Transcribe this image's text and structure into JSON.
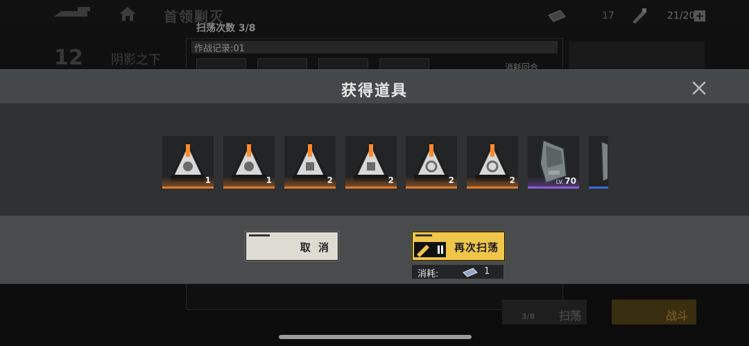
{
  "header": {
    "stage_title": "首领剿灭",
    "sweep_count": "扫荡次数 3/8",
    "tickets": "17",
    "energy": "21/200"
  },
  "background": {
    "stage_number": "12",
    "stage_name": "阴影之下",
    "record_title": "作战记录:01",
    "cost_rounds": "消耗回合",
    "bottom_count": "3/8",
    "bottom_sweep_label": "扫荡",
    "bottom_battle_label": "战斗"
  },
  "modal": {
    "title": "获得道具",
    "items": [
      {
        "name": "core-chip-a",
        "count": "1",
        "rarity": "orange"
      },
      {
        "name": "core-chip-b",
        "count": "1",
        "rarity": "orange"
      },
      {
        "name": "core-chip-c",
        "count": "2",
        "rarity": "orange"
      },
      {
        "name": "core-chip-d",
        "count": "2",
        "rarity": "orange"
      },
      {
        "name": "core-chip-e",
        "count": "2",
        "rarity": "orange"
      },
      {
        "name": "core-chip-f",
        "count": "2",
        "rarity": "orange"
      },
      {
        "name": "ship-module",
        "level_prefix": "LV.",
        "level": "70",
        "rarity": "purple"
      },
      {
        "name": "ship-module-2",
        "rarity": "blue"
      }
    ],
    "cancel_label": "取 消",
    "resweep_label": "再次扫荡",
    "cost_label": "消耗:",
    "cost_value": "1"
  },
  "colors": {
    "accent_yellow": "#efc64a",
    "rarity_orange": "#e07a2a",
    "rarity_purple": "#8a5cd6",
    "rarity_blue": "#3a6ad6"
  }
}
